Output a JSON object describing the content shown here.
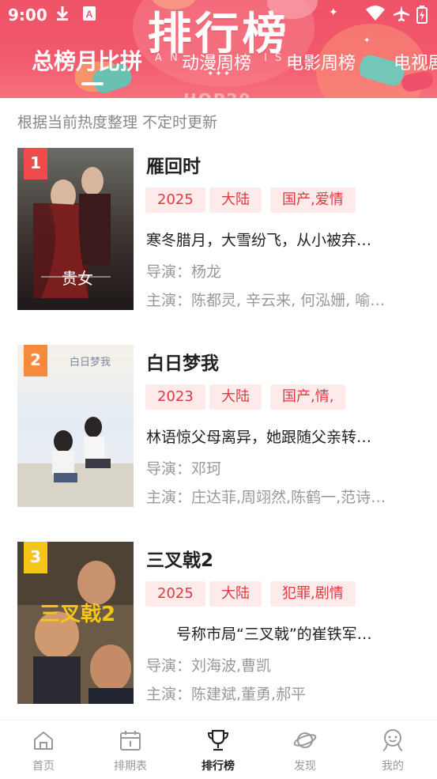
{
  "status_bar": {
    "time": "9:00",
    "icons": [
      "download-icon",
      "app-store-icon",
      "wifi-icon",
      "airplane-icon",
      "battery-charging-icon"
    ]
  },
  "header": {
    "big_title": "排行榜",
    "ghost_text": "HOP20",
    "spaced_letters_left": "A N",
    "spaced_letters_right": "I S",
    "decor_dots": "✦✦✦",
    "colors": {
      "gradient_top": "#ef5367",
      "gradient_bottom": "#f6707c"
    }
  },
  "tabs": [
    {
      "label": "总榜月比拼",
      "active": true
    },
    {
      "label": "动漫周榜",
      "active": false
    },
    {
      "label": "电影周榜",
      "active": false
    },
    {
      "label": "电视剧",
      "active": false
    }
  ],
  "subtitle": "根据当前热度整理 不定时更新",
  "accent_color": "#e2383f",
  "items": [
    {
      "rank": "1",
      "badge_color": "#f04a4a",
      "title": "雁回时",
      "tags": [
        "2025",
        "大陆",
        "国产,爱情"
      ],
      "description": "寒冬腊月，大雪纷飞，从小被弃…",
      "director_label": "导演：",
      "director": "杨龙",
      "cast_label": "主演：",
      "cast": "陈都灵, 辛云来, 何泓姗, 喻…",
      "poster_text": "贵女"
    },
    {
      "rank": "2",
      "badge_color": "#f58a3a",
      "title": "白日梦我",
      "tags": [
        "2023",
        "大陆",
        "国产,情,"
      ],
      "description": "林语惊父母离异，她跟随父亲转…",
      "director_label": "导演：",
      "director": "邓珂",
      "cast_label": "主演：",
      "cast": "庄达菲,周翊然,陈鹤一,范诗…",
      "poster_text": "白日梦我"
    },
    {
      "rank": "3",
      "badge_color": "#f5c518",
      "title": "三叉戟2",
      "tags": [
        "2025",
        "大陆",
        "犯罪,剧情"
      ],
      "description": "　　号称市局“三叉戟”的崔铁军…",
      "director_label": "导演：",
      "director": "刘海波,曹凯",
      "cast_label": "主演：",
      "cast": "陈建斌,董勇,郝平",
      "poster_text": "三叉戟2"
    }
  ],
  "bottom_nav": [
    {
      "label": "首页",
      "icon": "home-icon",
      "active": false
    },
    {
      "label": "排期表",
      "icon": "calendar-icon",
      "active": false
    },
    {
      "label": "排行榜",
      "icon": "trophy-icon",
      "active": true
    },
    {
      "label": "发现",
      "icon": "planet-icon",
      "active": false
    },
    {
      "label": "我的",
      "icon": "user-icon",
      "active": false
    }
  ]
}
